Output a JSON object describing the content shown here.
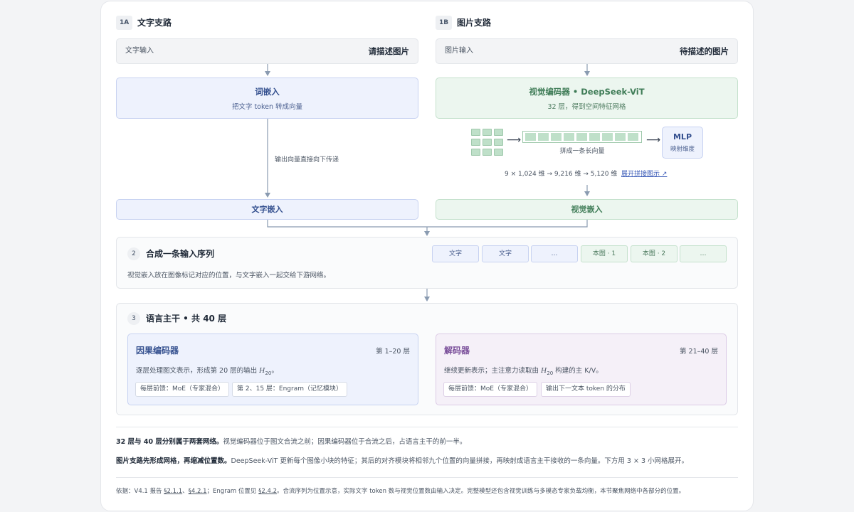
{
  "branch_text": {
    "badge": "1A",
    "title": "文字支路",
    "input_label": "文字输入",
    "input_value": "请描述图片",
    "embed_title": "词嵌入",
    "embed_sub": "把文字 token 转成向量",
    "pass_note": "输出向量直接向下传递",
    "output": "文字嵌入"
  },
  "branch_image": {
    "badge": "1B",
    "title": "图片支路",
    "input_label": "图片输入",
    "input_value": "待描述的图片",
    "encoder_title": "视觉编码器 • DeepSeek-ViT",
    "encoder_sub": "32 层，得到空间特征网格",
    "concat_label": "拼成一条长向量",
    "mlp_title": "MLP",
    "mlp_sub": "映射维度",
    "dims": "9 × 1,024 维 → 9,216 维 → 5,120 维",
    "expand_link": "展开拼接图示 ↗",
    "output": "视觉嵌入"
  },
  "merge": {
    "num": "2",
    "title": "合成一条输入序列",
    "desc": "视觉嵌入放在图像标记对应的位置，与文字嵌入一起交给下游网络。",
    "chips": [
      {
        "label": "文字",
        "kind": "text"
      },
      {
        "label": "文字",
        "kind": "text"
      },
      {
        "label": "…",
        "kind": "text"
      },
      {
        "label": "本图 · 1",
        "kind": "image"
      },
      {
        "label": "本图 · 2",
        "kind": "image"
      },
      {
        "label": "…",
        "kind": "image"
      }
    ]
  },
  "backbone": {
    "num": "3",
    "title": "语言主干 • 共 40 层",
    "encoder": {
      "title": "因果编码器",
      "range": "第 1–20 层",
      "desc_pre": "逐层处理图文表示，形成第 20 层的输出 ",
      "desc_var": "H",
      "desc_sub": "20",
      "desc_post": "。",
      "tags": [
        "每层前馈：MoE（专家混合）",
        "第 2、15 层：Engram（记忆模块）"
      ]
    },
    "decoder": {
      "title": "解码器",
      "range": "第 21–40 层",
      "desc_pre": "继续更新表示；主注意力读取由 ",
      "desc_var": "H",
      "desc_sub": "20",
      "desc_post": " 构建的主 K/V。",
      "tags": [
        "每层前馈：MoE（专家混合）",
        "输出下一文本 token 的分布"
      ]
    }
  },
  "notes": {
    "p1_bold": "32 层与 40 层分别属于两套网络。",
    "p1_rest": "视觉编码器位于图文合流之前；因果编码器位于合流之后，占语言主干的前一半。",
    "p2_bold": "图片支路先形成网格，再缩减位置数。",
    "p2_rest": "DeepSeek-ViT 更新每个图像小块的特征；其后的对齐模块将相邻九个位置的向量拼接，再映射成语言主干接收的一条向量。下方用 3 × 3 小网格展开。",
    "footer_pre": "依据：V4.1 报告 ",
    "footer_ref1": "§2.1.1",
    "footer_sep1": "、",
    "footer_ref2": "§4.2.1",
    "footer_mid": "；Engram 位置见 ",
    "footer_ref3": "§2.4.2",
    "footer_post": "。合流序列为位置示意，实际文字 token 数与视觉位置数由输入决定。完整模型还包含视觉训练与多模态专家负载均衡，本节聚焦网络中各部分的位置。"
  },
  "colors": {
    "text_blue": "#34508f",
    "text_green": "#3f7c57",
    "text_purple": "#7a4f9a",
    "connector": "#8a9bb1"
  }
}
